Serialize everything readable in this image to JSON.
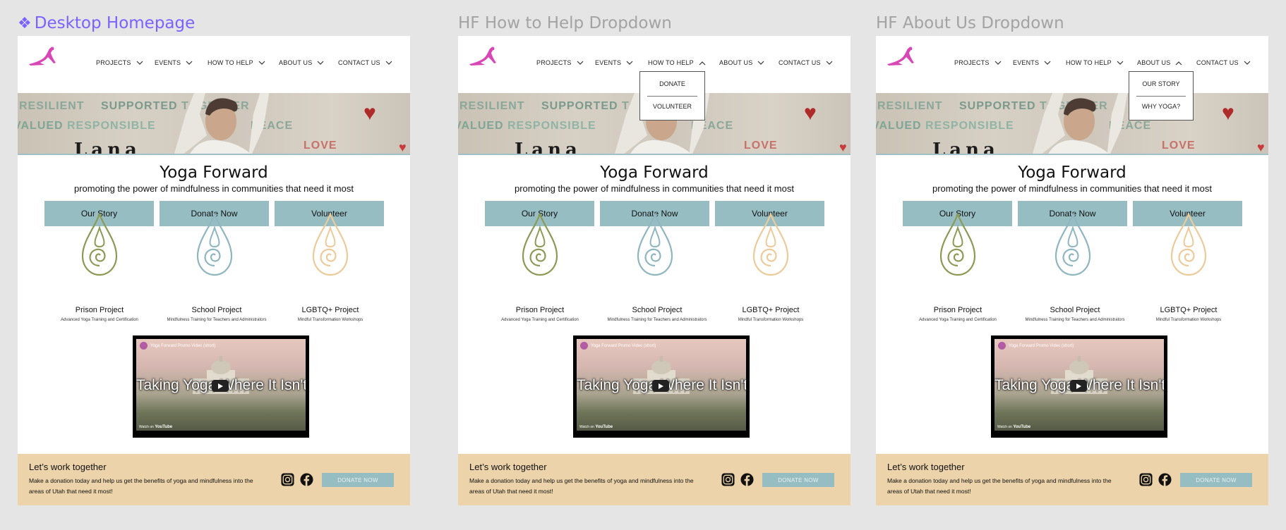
{
  "frame_labels": {
    "frame1": "Desktop Homepage",
    "frame2": "HF How to Help Dropdown",
    "frame3": "HF About Us Dropdown"
  },
  "nav": {
    "projects": "PROJECTS",
    "events": "EVENTS",
    "how_to_help": "HOW TO HELP",
    "about_us": "ABOUT US",
    "contact_us": "CONTACT US"
  },
  "hero": {
    "words": [
      "RESILIENT",
      "SUPPORTED",
      "TOGETHER",
      "RESPONSIBLE",
      "VALUED",
      "PEACE",
      "LOVE"
    ]
  },
  "home": {
    "title": "Yoga Forward",
    "tagline": "promoting the power of mindfulness in communities that need it most",
    "buttons": [
      "Our Story",
      "Donate Now",
      "Volunteer"
    ],
    "projects": [
      {
        "name": "Prison Project",
        "sub": "Advanced Yoga Training and Certification",
        "color": "#8c9a55"
      },
      {
        "name": "School Project",
        "sub": "Mindfulness Training for Teachers and Administrators",
        "color": "#8fb6c0"
      },
      {
        "name": "LGBTQ+ Project",
        "sub": "Mindful Transformation Workshops",
        "color": "#eccb9b"
      }
    ]
  },
  "video": {
    "header": "Yoga Forward Promo Video (short)",
    "caption": "Taking Yoga Where It Isn't",
    "watch_on": "Watch on",
    "youtube": "YouTube"
  },
  "footer": {
    "title": "Let’s work together",
    "text": "Make a donation today and help us get the benefits of yoga and mindfulness into the areas of Utah that need it most!",
    "button": "DONATE NOW"
  },
  "dropdowns": {
    "how_to_help": [
      "DONATE",
      "VOLUNTEER"
    ],
    "about_us": [
      "OUR STORY",
      "WHY YOGA?"
    ]
  },
  "colors": {
    "accent": "#96bdc2",
    "footer_bg": "#ecd3aa",
    "logo": "#d946b5",
    "figma_label": "#7b61ff"
  }
}
